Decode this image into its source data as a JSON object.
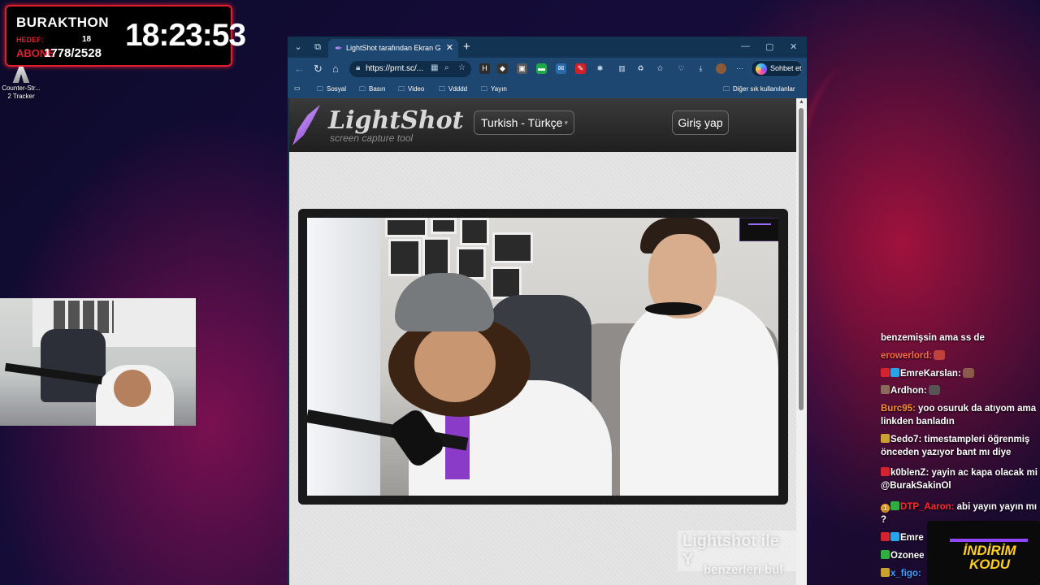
{
  "timer": {
    "title": "BURAKTHON",
    "goal_label": "HEDEF:",
    "goal_value": "18",
    "sub_label": "ABONE",
    "sub_value": "1778/2528",
    "clock": "18:23:53",
    "accent": "#e21e2e"
  },
  "desktop_icon": {
    "label": "Counter-Str... 2 Tracker",
    "icon": "cs2-tracker-icon"
  },
  "browser": {
    "tab_title": "LightShot tarafından Ekran Görünt",
    "url": "https://prnt.sc/...",
    "chat_button": "Sohbet et",
    "bookmarks": [
      "Sosyal",
      "Basın",
      "Video",
      "Vdddd",
      "Yayın"
    ],
    "other_bookmarks": "Diğer sık kullanılanlar",
    "theme_color": "#1d4670"
  },
  "lightshot": {
    "logo_text": "LightShot",
    "tagline": "screen capture tool",
    "language": "Turkish - Türkçe",
    "login": "Giriş yap",
    "ghost_title": "Lightshot ile Y",
    "ghost_subtitle": "benzerleri bul"
  },
  "chat": {
    "messages": [
      {
        "user": "",
        "text": "benzemişsin ama ss de",
        "user_color": "#ffffff"
      },
      {
        "user": "erowerlord:",
        "text": "",
        "user_color": "#ff6a3d"
      },
      {
        "user": "EmreKarslan:",
        "text": "",
        "user_color": "#ffffff"
      },
      {
        "user": "Ardhon:",
        "text": "",
        "user_color": "#ffffff"
      },
      {
        "user": "Burc95:",
        "text": "yoo osuruk da atıyom ama linkden banladın",
        "user_color": "#ff8a2a"
      },
      {
        "user": "Sedo7:",
        "text": "timestampleri öğrenmiş önceden yazıyor bant mı diye",
        "user_color": "#ffffff"
      },
      {
        "user": "k0blenZ:",
        "text": "yayin ac kapa olacak mi @BurakSakinOl",
        "user_color": "#ffffff"
      },
      {
        "user": "DTP_Aaron:",
        "text": "abi yayın yayın mı ?",
        "user_color": "#ff2a2a"
      },
      {
        "user": "Emre",
        "text": "",
        "user_color": "#ffffff"
      },
      {
        "user": "Ozonee",
        "text": "",
        "user_color": "#ffffff"
      },
      {
        "user": "x_figo:",
        "text": "",
        "user_color": "#3aa0ff"
      }
    ],
    "promo": "İNDİRİM KODU"
  }
}
